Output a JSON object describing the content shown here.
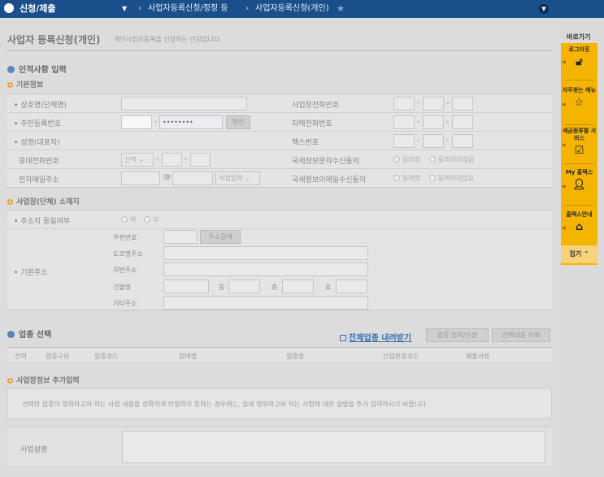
{
  "nav": {
    "menu": "신청/제출",
    "crumb1": "사업자등록신청/정정 등",
    "crumb2": "사업자등록신청(개인)"
  },
  "page": {
    "title": "사업자 등록신청(개인)",
    "subtitle": "개인사업자등록을 신청하는 민원입니다."
  },
  "personal": {
    "section": "인적사항 입력",
    "sub": "기본정보",
    "trade_name_label": "상호명(단체명)",
    "rrn_label": "주민등록번호",
    "rrn_masked": "••••••••",
    "confirm_btn": "확인",
    "name_label": "성명(대표자)",
    "mobile_label": "휴대전화번호",
    "mobile_select": "선택",
    "email_label": "전자메일주소",
    "email_at": "@",
    "email_select": "직접입력",
    "biz_phone_label": "사업장전화번호",
    "home_phone_label": "자택전화번호",
    "fax_label": "팩스번호",
    "sms_label": "국세정보문자수신동의",
    "mail_label": "국세정보이메일수신동의",
    "agree": "동의함",
    "disagree": "동의하지않음"
  },
  "address": {
    "sub": "사업장(단체) 소재지",
    "same_label": "주소지 동일여부",
    "yes": "여",
    "no": "부",
    "base_label": "기본주소",
    "postcode_label": "우편번호",
    "search_btn": "주소검색",
    "road_label": "도로명주소",
    "jibun_label": "지번주소",
    "building_label": "건물명",
    "dong": "동",
    "floor": "층",
    "ho": "호",
    "etc_label": "기타주소"
  },
  "industry": {
    "section": "업종 선택",
    "download": "전체업종 내려받기",
    "input_btn": "업종 입력/수정",
    "delete_btn": "선택내용 삭제",
    "columns": [
      "선택",
      "업종구분",
      "업종코드",
      "업태명",
      "업종명",
      "산업분류코드",
      "제출서류"
    ]
  },
  "extra": {
    "sub": "사업장정보 추가입력",
    "notice": "· 선택한 업종이 영위하고자 하는 사업 내용을 정확하게 반영하지 못하는 경우에는, 실제 영위하고자 하는 사업에 대한 설명을 추가 입력하시기 바랍니다.",
    "desc_label": "사업설명"
  },
  "quick": {
    "title": "바로가기",
    "items": [
      "로그아웃",
      "자주찾는 메뉴",
      "세금종류별 서비스",
      "My 홈택스",
      "홈택스안내"
    ],
    "fold": "접기"
  },
  "colors": {
    "nav": "#1a4f8c",
    "quickbar": "#f4b400",
    "required": "#d04a4a",
    "link": "#3a6fb0"
  }
}
